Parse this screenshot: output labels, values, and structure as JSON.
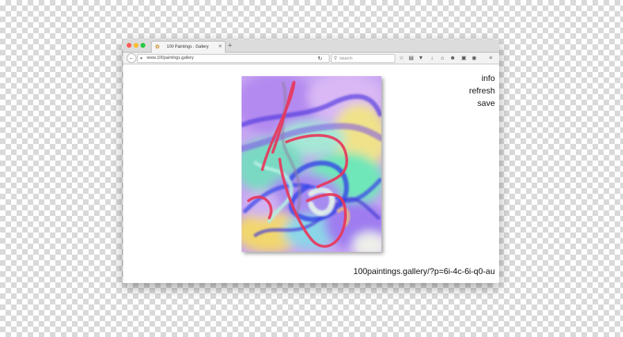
{
  "browser": {
    "tab": {
      "title": "100 Paintings . Gallery",
      "favicon": "bee-icon"
    },
    "address_bar": {
      "url": "www.100paintings.gallery"
    },
    "search": {
      "placeholder": "Search"
    },
    "toolbar_icons": [
      "reload-icon",
      "bookmark-star-icon",
      "reading-list-icon",
      "pocket-icon",
      "download-icon",
      "home-icon",
      "sync-icon",
      "extension-icon",
      "extension-icon",
      "hamburger-menu-icon"
    ]
  },
  "page": {
    "menu": {
      "info": "info",
      "refresh": "refresh",
      "save": "save"
    },
    "permalink": "100paintings.gallery/?p=6i-4c-6i-q0-au",
    "painting": {
      "style": "abstract digital painting",
      "palette": [
        "#b48ef0",
        "#8f5ae6",
        "#3f49e8",
        "#4fe0b6",
        "#e83c5c",
        "#f2e36e"
      ]
    }
  }
}
